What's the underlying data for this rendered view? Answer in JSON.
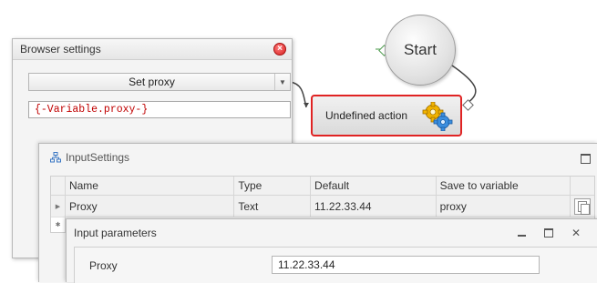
{
  "canvas": {
    "start_node_label": "Start",
    "action_node_label": "Undefined action",
    "action_border_color": "#e02323",
    "action_icon": "gears-icon"
  },
  "browser_settings": {
    "title": "Browser settings",
    "close_icon": "close-icon",
    "action_select": "Set proxy",
    "proxy_value": "{-Variable.proxy-}"
  },
  "input_settings": {
    "title": "InputSettings",
    "title_icon": "tree-icon",
    "columns": [
      "Name",
      "Type",
      "Default",
      "Save to variable"
    ],
    "rows": [
      {
        "name": "Proxy",
        "type": "Text",
        "default": "11.22.33.44",
        "save_to": "proxy"
      }
    ]
  },
  "input_parameters": {
    "title": "Input parameters",
    "field_label": "Proxy",
    "field_value": "11.22.33.44"
  }
}
